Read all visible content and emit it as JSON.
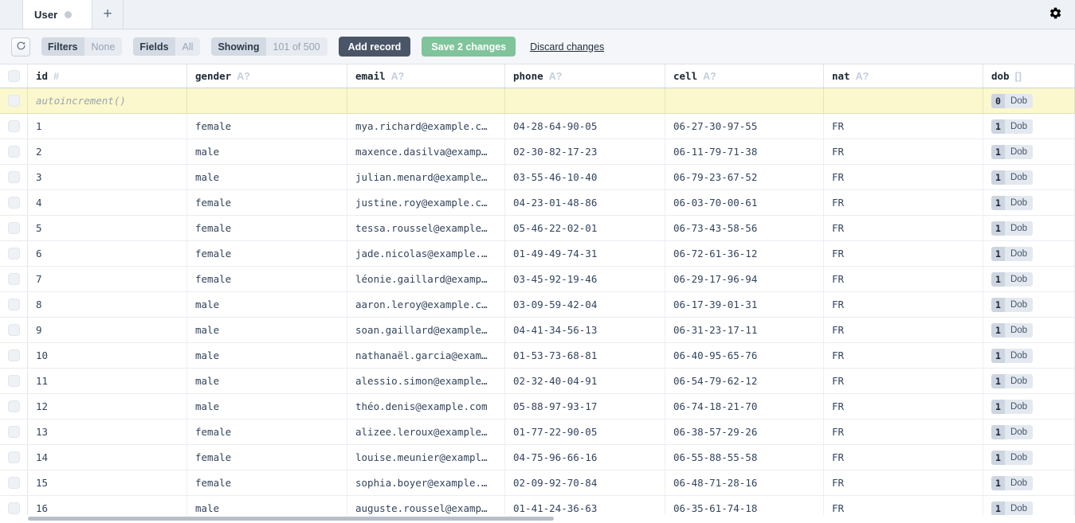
{
  "tabbar": {
    "tabs": [
      {
        "label": "User",
        "dirty": true
      }
    ],
    "add_tab_label": "+",
    "gear_icon": "gear-icon"
  },
  "toolbar": {
    "refresh_icon": "refresh-icon",
    "segments": [
      {
        "key": "Filters",
        "value": "None"
      },
      {
        "key": "Fields",
        "value": "All"
      },
      {
        "key": "Showing",
        "value": "101 of 500"
      }
    ],
    "add_record_label": "Add record",
    "save_label": "Save 2 changes",
    "discard_label": "Discard changes",
    "accent_primary": "#4a5568",
    "accent_save": "#7fc49b"
  },
  "grid": {
    "columns": [
      {
        "name": "id",
        "type_icon": "#"
      },
      {
        "name": "gender",
        "type_icon": "A?"
      },
      {
        "name": "email",
        "type_icon": "A?"
      },
      {
        "name": "phone",
        "type_icon": "A?"
      },
      {
        "name": "cell",
        "type_icon": "A?"
      },
      {
        "name": "nat",
        "type_icon": "A?"
      },
      {
        "name": "dob",
        "type_icon": "[]"
      }
    ],
    "new_row": {
      "id_placeholder": "autoincrement()",
      "gender": "",
      "email": "",
      "phone": "",
      "cell": "",
      "nat": "",
      "dob_count": "0",
      "dob_label": "Dob"
    },
    "dob_label": "Dob",
    "rows": [
      {
        "id": "1",
        "gender": "female",
        "email": "mya.richard@example.c…",
        "phone": "04-28-64-90-05",
        "cell": "06-27-30-97-55",
        "nat": "FR",
        "dob_count": "1"
      },
      {
        "id": "2",
        "gender": "male",
        "email": "maxence.dasilva@examp…",
        "phone": "02-30-82-17-23",
        "cell": "06-11-79-71-38",
        "nat": "FR",
        "dob_count": "1"
      },
      {
        "id": "3",
        "gender": "male",
        "email": "julian.menard@example…",
        "phone": "03-55-46-10-40",
        "cell": "06-79-23-67-52",
        "nat": "FR",
        "dob_count": "1"
      },
      {
        "id": "4",
        "gender": "female",
        "email": "justine.roy@example.c…",
        "phone": "04-23-01-48-86",
        "cell": "06-03-70-00-61",
        "nat": "FR",
        "dob_count": "1"
      },
      {
        "id": "5",
        "gender": "female",
        "email": "tessa.roussel@example…",
        "phone": "05-46-22-02-01",
        "cell": "06-73-43-58-56",
        "nat": "FR",
        "dob_count": "1"
      },
      {
        "id": "6",
        "gender": "female",
        "email": "jade.nicolas@example.…",
        "phone": "01-49-49-74-31",
        "cell": "06-72-61-36-12",
        "nat": "FR",
        "dob_count": "1"
      },
      {
        "id": "7",
        "gender": "female",
        "email": "léonie.gaillard@examp…",
        "phone": "03-45-92-19-46",
        "cell": "06-29-17-96-94",
        "nat": "FR",
        "dob_count": "1"
      },
      {
        "id": "8",
        "gender": "male",
        "email": "aaron.leroy@example.c…",
        "phone": "03-09-59-42-04",
        "cell": "06-17-39-01-31",
        "nat": "FR",
        "dob_count": "1"
      },
      {
        "id": "9",
        "gender": "male",
        "email": "soan.gaillard@example…",
        "phone": "04-41-34-56-13",
        "cell": "06-31-23-17-11",
        "nat": "FR",
        "dob_count": "1"
      },
      {
        "id": "10",
        "gender": "male",
        "email": "nathanaël.garcia@exam…",
        "phone": "01-53-73-68-81",
        "cell": "06-40-95-65-76",
        "nat": "FR",
        "dob_count": "1"
      },
      {
        "id": "11",
        "gender": "male",
        "email": "alessio.simon@example…",
        "phone": "02-32-40-04-91",
        "cell": "06-54-79-62-12",
        "nat": "FR",
        "dob_count": "1"
      },
      {
        "id": "12",
        "gender": "male",
        "email": "théo.denis@example.com",
        "phone": "05-88-97-93-17",
        "cell": "06-74-18-21-70",
        "nat": "FR",
        "dob_count": "1"
      },
      {
        "id": "13",
        "gender": "female",
        "email": "alizee.leroux@example…",
        "phone": "01-77-22-90-05",
        "cell": "06-38-57-29-26",
        "nat": "FR",
        "dob_count": "1"
      },
      {
        "id": "14",
        "gender": "female",
        "email": "louise.meunier@exampl…",
        "phone": "04-75-96-66-16",
        "cell": "06-55-88-55-58",
        "nat": "FR",
        "dob_count": "1"
      },
      {
        "id": "15",
        "gender": "female",
        "email": "sophia.boyer@example.…",
        "phone": "02-09-92-70-84",
        "cell": "06-48-71-28-16",
        "nat": "FR",
        "dob_count": "1"
      },
      {
        "id": "16",
        "gender": "male",
        "email": "auguste.roussel@examp…",
        "phone": "01-41-24-36-63",
        "cell": "06-35-61-74-18",
        "nat": "FR",
        "dob_count": "1"
      }
    ]
  }
}
